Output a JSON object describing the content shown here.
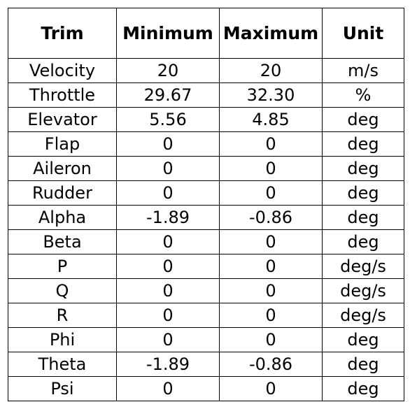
{
  "table": {
    "name": "trim-conditions-table",
    "columns": [
      {
        "key": "trim",
        "label": "Trim"
      },
      {
        "key": "minimum",
        "label": "Minimum"
      },
      {
        "key": "maximum",
        "label": "Maximum"
      },
      {
        "key": "unit",
        "label": "Unit"
      }
    ],
    "rows": [
      {
        "trim": "Velocity",
        "minimum": "20",
        "maximum": "20",
        "unit": "m/s"
      },
      {
        "trim": "Throttle",
        "minimum": "29.67",
        "maximum": "32.30",
        "unit": "%"
      },
      {
        "trim": "Elevator",
        "minimum": "5.56",
        "maximum": "4.85",
        "unit": "deg"
      },
      {
        "trim": "Flap",
        "minimum": "0",
        "maximum": "0",
        "unit": "deg"
      },
      {
        "trim": "Aileron",
        "minimum": "0",
        "maximum": "0",
        "unit": "deg"
      },
      {
        "trim": "Rudder",
        "minimum": "0",
        "maximum": "0",
        "unit": "deg"
      },
      {
        "trim": "Alpha",
        "minimum": "-1.89",
        "maximum": "-0.86",
        "unit": "deg"
      },
      {
        "trim": "Beta",
        "minimum": "0",
        "maximum": "0",
        "unit": "deg"
      },
      {
        "trim": "P",
        "minimum": "0",
        "maximum": "0",
        "unit": "deg/s"
      },
      {
        "trim": "Q",
        "minimum": "0",
        "maximum": "0",
        "unit": "deg/s"
      },
      {
        "trim": "R",
        "minimum": "0",
        "maximum": "0",
        "unit": "deg/s"
      },
      {
        "trim": "Phi",
        "minimum": "0",
        "maximum": "0",
        "unit": "deg"
      },
      {
        "trim": "Theta",
        "minimum": "-1.89",
        "maximum": "-0.86",
        "unit": "deg"
      },
      {
        "trim": "Psi",
        "minimum": "0",
        "maximum": "0",
        "unit": "deg"
      }
    ]
  },
  "style": {
    "border_color": "#000000",
    "text_color": "#000000",
    "background": "#ffffff"
  }
}
